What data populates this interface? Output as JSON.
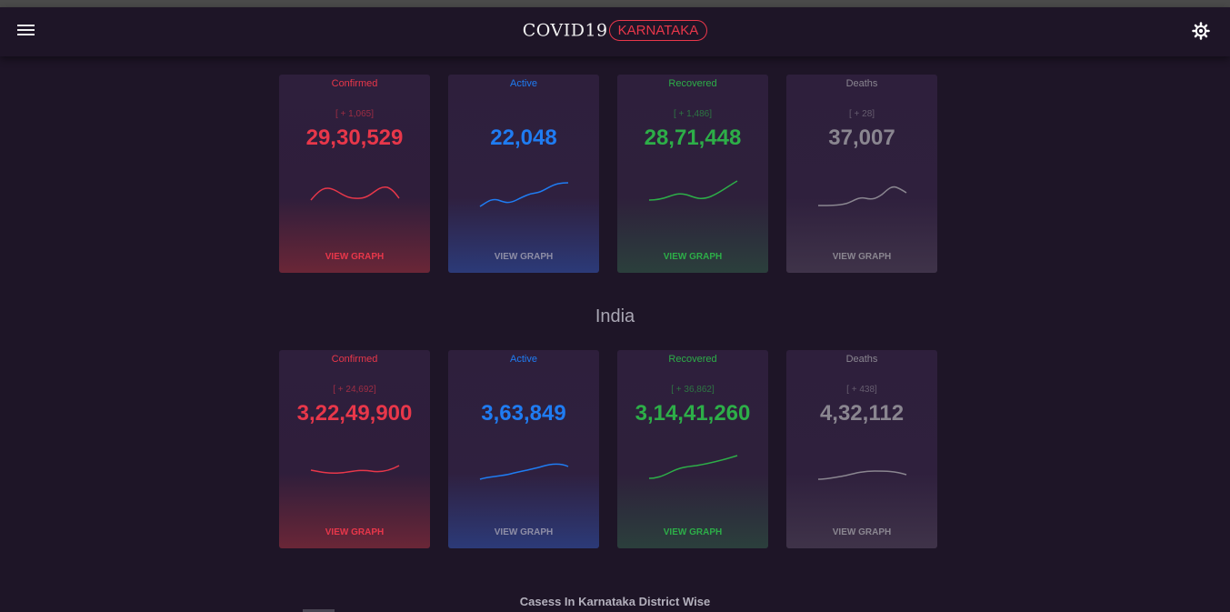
{
  "header": {
    "brand": "COVID19",
    "region": "KARNATAKA"
  },
  "colors": {
    "confirmed": "#e8374a",
    "active": "#1f7cf2",
    "recovered": "#2dae48",
    "deaths": "#8a8690",
    "background": "#1e1527"
  },
  "icons": {
    "menu": "hamburger-icon",
    "theme": "brightness-icon"
  },
  "karnataka": {
    "confirmed": {
      "title": "Confirmed",
      "delta": "[ + 1,065]",
      "value": "29,30,529",
      "link": "VIEW GRAPH"
    },
    "active": {
      "title": "Active",
      "delta": "",
      "value": "22,048",
      "link": "VIEW GRAPH"
    },
    "recovered": {
      "title": "Recovered",
      "delta": "[ + 1,486]",
      "value": "28,71,448",
      "link": "VIEW GRAPH"
    },
    "deaths": {
      "title": "Deaths",
      "delta": "[ + 28]",
      "value": "37,007",
      "link": "VIEW GRAPH"
    }
  },
  "india_title": "India",
  "india": {
    "confirmed": {
      "title": "Confirmed",
      "delta": "[ + 24,692]",
      "value": "3,22,49,900",
      "link": "VIEW GRAPH"
    },
    "active": {
      "title": "Active",
      "delta": "",
      "value": "3,63,849",
      "link": "VIEW GRAPH"
    },
    "recovered": {
      "title": "Recovered",
      "delta": "[ + 36,862]",
      "value": "3,14,41,260",
      "link": "VIEW GRAPH"
    },
    "deaths": {
      "title": "Deaths",
      "delta": "[ + 438]",
      "value": "4,32,112",
      "link": "VIEW GRAPH"
    }
  },
  "district_title": "Casess In Karnataka District Wise"
}
